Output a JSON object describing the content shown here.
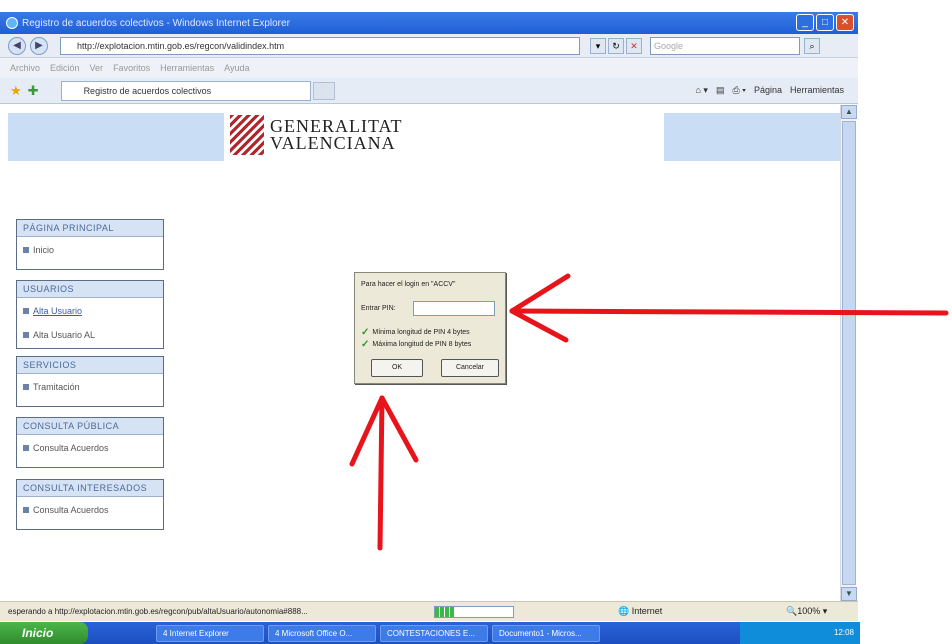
{
  "window": {
    "title": "Registro de acuerdos colectivos - Windows Internet Explorer",
    "url": "http://explotacion.mtin.gob.es/regcon/validindex.htm",
    "search_placeholder": "Google",
    "menu_items": [
      "Archivo",
      "Edición",
      "Ver",
      "Favoritos",
      "Herramientas",
      "Ayuda"
    ],
    "tab_label": "Registro de acuerdos colectivos",
    "tools": [
      "Página",
      "Herramientas"
    ]
  },
  "header": {
    "logo_line1": "GENERALITAT",
    "logo_line2": "VALENCIANA"
  },
  "sidebar": [
    {
      "heading": "PÁGINA PRINCIPAL",
      "items": [
        {
          "label": "Inicio",
          "link": false
        }
      ]
    },
    {
      "heading": "USUARIOS",
      "items": [
        {
          "label": "Alta Usuario",
          "link": true
        },
        {
          "label": "Alta Usuario AL",
          "link": false
        }
      ]
    },
    {
      "heading": "SERVICIOS",
      "items": [
        {
          "label": "Tramitación",
          "link": false
        }
      ]
    },
    {
      "heading": "CONSULTA PÚBLICA",
      "items": [
        {
          "label": "Consulta Acuerdos",
          "link": false
        }
      ]
    },
    {
      "heading": "CONSULTA INTERESADOS",
      "items": [
        {
          "label": "Consulta Acuerdos",
          "link": false
        }
      ]
    }
  ],
  "dialog": {
    "message": "Para hacer el login en \"ACCV\"",
    "pin_label": "Entrar PIN:",
    "requirements": [
      "Mínima longitud de PIN 4 bytes",
      "Máxima longitud de PIN 8 bytes"
    ],
    "ok_label": "OK",
    "cancel_label": "Cancelar"
  },
  "statusbar": {
    "text": "esperando a http://explotacion.mtin.gob.es/regcon/pub/altaUsuario/autonomia#888...",
    "progress": 0.25,
    "zone": "Internet",
    "zoom": "100%"
  },
  "taskbar": {
    "start_label": "Inicio",
    "buttons": [
      "4 Internet Explorer",
      "4 Microsoft Office O...",
      "CONTESTACIONES E...",
      "Documento1 - Micros..."
    ],
    "clock": "12:08"
  },
  "colors": {
    "arrow": "#e8141b",
    "header_band": "#c9ddf4"
  }
}
